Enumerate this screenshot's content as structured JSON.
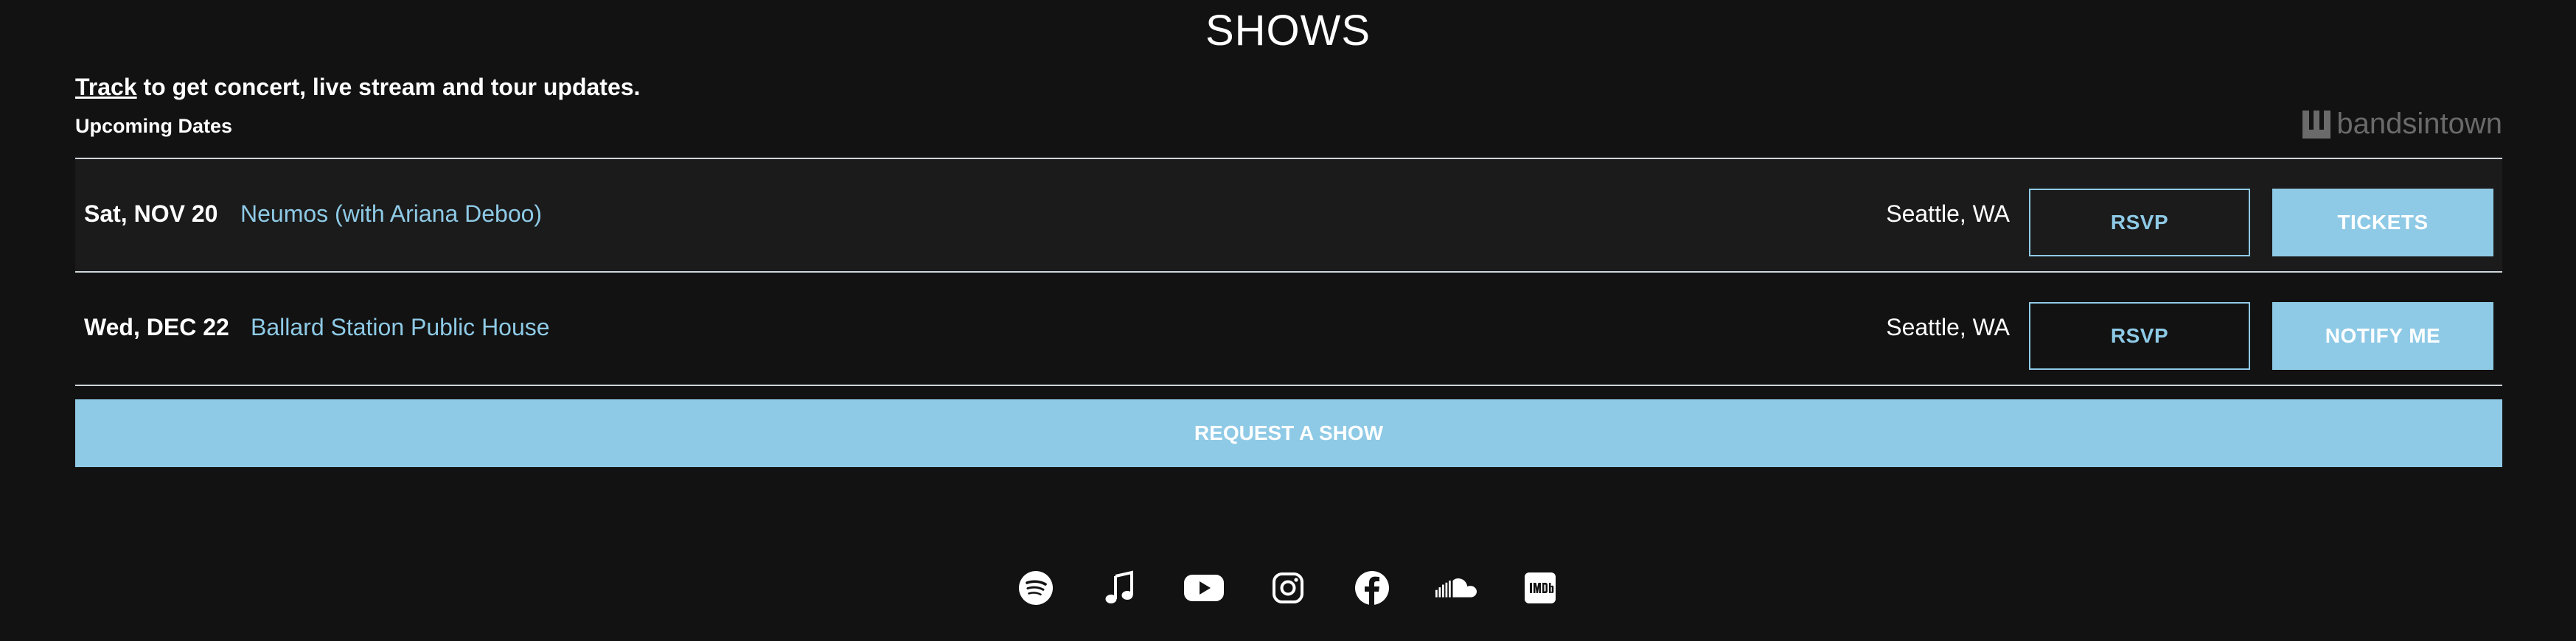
{
  "page": {
    "title": "SHOWS",
    "track_link": "Track",
    "track_rest": " to get concert, live stream and tour updates.",
    "upcoming_label": "Upcoming Dates",
    "bandsintown_logo_text": "bandsintown"
  },
  "shows": [
    {
      "date": "Sat, NOV 20",
      "venue": "Neumos (with Ariana Deboo)",
      "location": "Seattle, WA",
      "rsvp": "RSVP",
      "action": "TICKETS"
    },
    {
      "date": "Wed, DEC 22",
      "venue": "Ballard Station Public House",
      "location": "Seattle, WA",
      "rsvp": "RSVP",
      "action": "NOTIFY ME"
    }
  ],
  "request_button": "REQUEST A SHOW",
  "socials": [
    "spotify-icon",
    "apple-music-icon",
    "youtube-icon",
    "instagram-icon",
    "facebook-icon",
    "soundcloud-icon",
    "imdb-icon"
  ],
  "colors": {
    "background": "#121212",
    "accent": "#8ecae6",
    "row_shade": "#1b1b1b",
    "divider": "#cfd6da"
  }
}
